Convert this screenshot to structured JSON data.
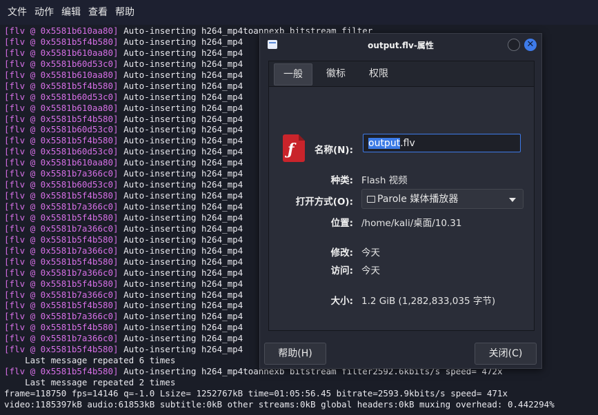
{
  "menubar": [
    "文件",
    "动作",
    "编辑",
    "查看",
    "帮助"
  ],
  "terminal": {
    "lines": [
      {
        "ctx": "[flv @ 0x5581b610aa80]",
        "text": " Auto-inserting h264_mp4toannexb bitstream filter"
      },
      {
        "ctx": "[flv @ 0x5581b5f4b580]",
        "text": " Auto-inserting h264_mp4"
      },
      {
        "ctx": "[flv @ 0x5581b610aa80]",
        "text": " Auto-inserting h264_mp4"
      },
      {
        "ctx": "[flv @ 0x5581b60d53c0]",
        "text": " Auto-inserting h264_mp4"
      },
      {
        "ctx": "[flv @ 0x5581b610aa80]",
        "text": " Auto-inserting h264_mp4"
      },
      {
        "ctx": "[flv @ 0x5581b5f4b580]",
        "text": " Auto-inserting h264_mp4"
      },
      {
        "ctx": "[flv @ 0x5581b60d53c0]",
        "text": " Auto-inserting h264_mp4"
      },
      {
        "ctx": "[flv @ 0x5581b610aa80]",
        "text": " Auto-inserting h264_mp4"
      },
      {
        "ctx": "[flv @ 0x5581b5f4b580]",
        "text": " Auto-inserting h264_mp4"
      },
      {
        "ctx": "[flv @ 0x5581b60d53c0]",
        "text": " Auto-inserting h264_mp4"
      },
      {
        "ctx": "[flv @ 0x5581b5f4b580]",
        "text": " Auto-inserting h264_mp4"
      },
      {
        "ctx": "[flv @ 0x5581b60d53c0]",
        "text": " Auto-inserting h264_mp4"
      },
      {
        "ctx": "[flv @ 0x5581b610aa80]",
        "text": " Auto-inserting h264_mp4"
      },
      {
        "ctx": "[flv @ 0x5581b7a366c0]",
        "text": " Auto-inserting h264_mp4"
      },
      {
        "ctx": "[flv @ 0x5581b60d53c0]",
        "text": " Auto-inserting h264_mp4"
      },
      {
        "ctx": "[flv @ 0x5581b5f4b580]",
        "text": " Auto-inserting h264_mp4"
      },
      {
        "ctx": "[flv @ 0x5581b7a366c0]",
        "text": " Auto-inserting h264_mp4"
      },
      {
        "ctx": "[flv @ 0x5581b5f4b580]",
        "text": " Auto-inserting h264_mp4"
      },
      {
        "ctx": "[flv @ 0x5581b7a366c0]",
        "text": " Auto-inserting h264_mp4"
      },
      {
        "ctx": "[flv @ 0x5581b5f4b580]",
        "text": " Auto-inserting h264_mp4"
      },
      {
        "ctx": "[flv @ 0x5581b7a366c0]",
        "text": " Auto-inserting h264_mp4"
      },
      {
        "ctx": "[flv @ 0x5581b5f4b580]",
        "text": " Auto-inserting h264_mp4"
      },
      {
        "ctx": "[flv @ 0x5581b7a366c0]",
        "text": " Auto-inserting h264_mp4"
      },
      {
        "ctx": "[flv @ 0x5581b5f4b580]",
        "text": " Auto-inserting h264_mp4"
      },
      {
        "ctx": "[flv @ 0x5581b7a366c0]",
        "text": " Auto-inserting h264_mp4"
      },
      {
        "ctx": "[flv @ 0x5581b5f4b580]",
        "text": " Auto-inserting h264_mp4"
      },
      {
        "ctx": "[flv @ 0x5581b7a366c0]",
        "text": " Auto-inserting h264_mp4"
      },
      {
        "ctx": "[flv @ 0x5581b5f4b580]",
        "text": " Auto-inserting h264_mp4"
      },
      {
        "ctx": "[flv @ 0x5581b7a366c0]",
        "text": " Auto-inserting h264_mp4"
      },
      {
        "ctx": "[flv @ 0x5581b5f4b580]",
        "text": " Auto-inserting h264_mp4"
      },
      {
        "ctx": "",
        "text": "    Last message repeated 6 times"
      },
      {
        "ctx": "[flv @ 0x5581b5f4b580]",
        "text": " Auto-inserting h264_mp4toannexb bitstream filter2592.6kbits/s speed= 472x"
      },
      {
        "ctx": "",
        "text": "    Last message repeated 2 times"
      },
      {
        "ctx": "",
        "text": "frame=118750 fps=14146 q=-1.0 Lsize= 1252767kB time=01:05:56.45 bitrate=2593.9kbits/s speed= 471x"
      },
      {
        "ctx": "",
        "text": "video:1185397kB audio:61853kB subtitle:0kB other streams:0kB global headers:0kB muxing overhead: 0.442294%"
      }
    ]
  },
  "dialog": {
    "title": "output.flv-属性",
    "tabs": [
      "一般",
      "徽标",
      "权限"
    ],
    "name_label": "名称(N):",
    "name_selected": "output",
    "name_rest": ".flv",
    "type_label": "种类:",
    "type_value": "Flash 视频",
    "open_label": "打开方式(O):",
    "open_value": "Parole 媒体播放器",
    "location_label": "位置:",
    "location_value": "/home/kali/桌面/10.31",
    "modified_label": "修改:",
    "modified_value": "今天",
    "accessed_label": "访问:",
    "accessed_value": "今天",
    "size_label": "大小:",
    "size_value": "1.2 GiB (1,282,833,035 字节)",
    "help_button": "帮助(H)",
    "close_button": "关闭(C)"
  }
}
